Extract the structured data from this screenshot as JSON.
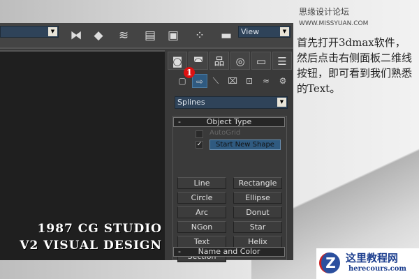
{
  "site_header": {
    "name": "思缘设计论坛",
    "url": "WWW.MISSYUAN.COM"
  },
  "toolbar": {
    "left_dropdown": "",
    "view_dropdown": "View"
  },
  "command_panel": {
    "tabs": [
      "create",
      "modify",
      "hierarchy",
      "motion",
      "display",
      "utilities"
    ],
    "subcategories": [
      "geometry",
      "shapes",
      "lights",
      "cameras",
      "helpers",
      "space-warps",
      "systems"
    ],
    "callout_number": "1",
    "category_dropdown": "Splines",
    "object_type": {
      "title": "Object Type",
      "collapse": "-",
      "autogrid": {
        "label": "AutoGrid",
        "checked": false
      },
      "start_new_shape": {
        "label": "Start New Shape",
        "checked": true
      },
      "buttons": [
        "Line",
        "Rectangle",
        "Circle",
        "Ellipse",
        "Arc",
        "Donut",
        "NGon",
        "Star",
        "Text",
        "Helix",
        "Section"
      ]
    },
    "name_and_color": {
      "title": "Name and Color",
      "collapse": "-"
    }
  },
  "watermark": {
    "line1": "1987 CG STUDIO",
    "line2": "V2 VISUAL DESIGN"
  },
  "description": "首先打开3dmax软件，然后点击右侧面板二维线按钮，即可看到我们熟悉的Text。",
  "logo": {
    "name": "这里教程网",
    "url": "herecours.com"
  }
}
